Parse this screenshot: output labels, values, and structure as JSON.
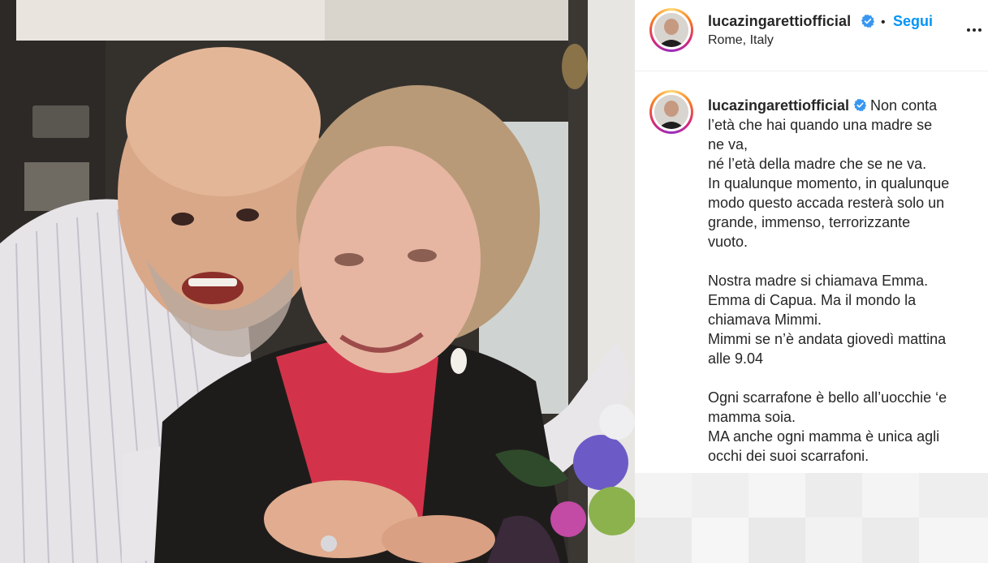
{
  "post": {
    "username": "lucazingarettiofficial",
    "separator": "•",
    "follow_label": "Segui",
    "location": "Rome, Italy"
  },
  "caption": {
    "username": "lucazingarettiofficial",
    "first_line": "Non conta",
    "lines": [
      "l’età che hai quando una madre se",
      "ne va,",
      "né l’età della madre che se ne va.",
      "In qualunque momento, in qualunque",
      "modo questo accada resterà solo un",
      "grande, immenso, terrorizzante",
      "vuoto.",
      "",
      "Nostra madre si chiamava Emma.",
      "Emma di Capua. Ma il mondo la",
      "chiamava Mimmi.",
      "Mimmi se n’è andata giovedì mattina",
      "alle 9.04",
      "",
      "Ogni scarrafone è bello all’uocchie ‘e",
      "mamma soia.",
      "MA anche ogni mamma è unica agli",
      "occhi dei suoi scarrafoni."
    ]
  },
  "icons": {
    "verified": "verified-badge-icon",
    "more": "more-options-icon"
  },
  "colors": {
    "link_blue": "#0095f6",
    "verified_blue": "#3897f0",
    "text": "#262626"
  }
}
